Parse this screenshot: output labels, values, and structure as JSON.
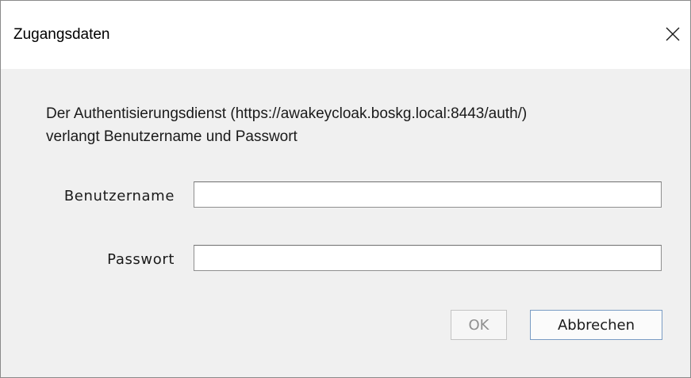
{
  "dialog": {
    "title": "Zugangsdaten",
    "message_line1": "Der Authentisierungsdienst (https://awakeycloak.boskg.local:8443/auth/)",
    "message_line2": "verlangt Benutzername und Passwort"
  },
  "form": {
    "username_label": "Benutzername",
    "username_value": "",
    "password_label": "Passwort",
    "password_value": ""
  },
  "buttons": {
    "ok_label": "OK",
    "cancel_label": "Abbrechen"
  },
  "icons": {
    "close": "close-icon"
  },
  "colors": {
    "dialog_background": "#f0f0f0",
    "titlebar_background": "#ffffff",
    "disabled_text": "#8f8f8f",
    "focus_border": "#7a9cc4"
  }
}
